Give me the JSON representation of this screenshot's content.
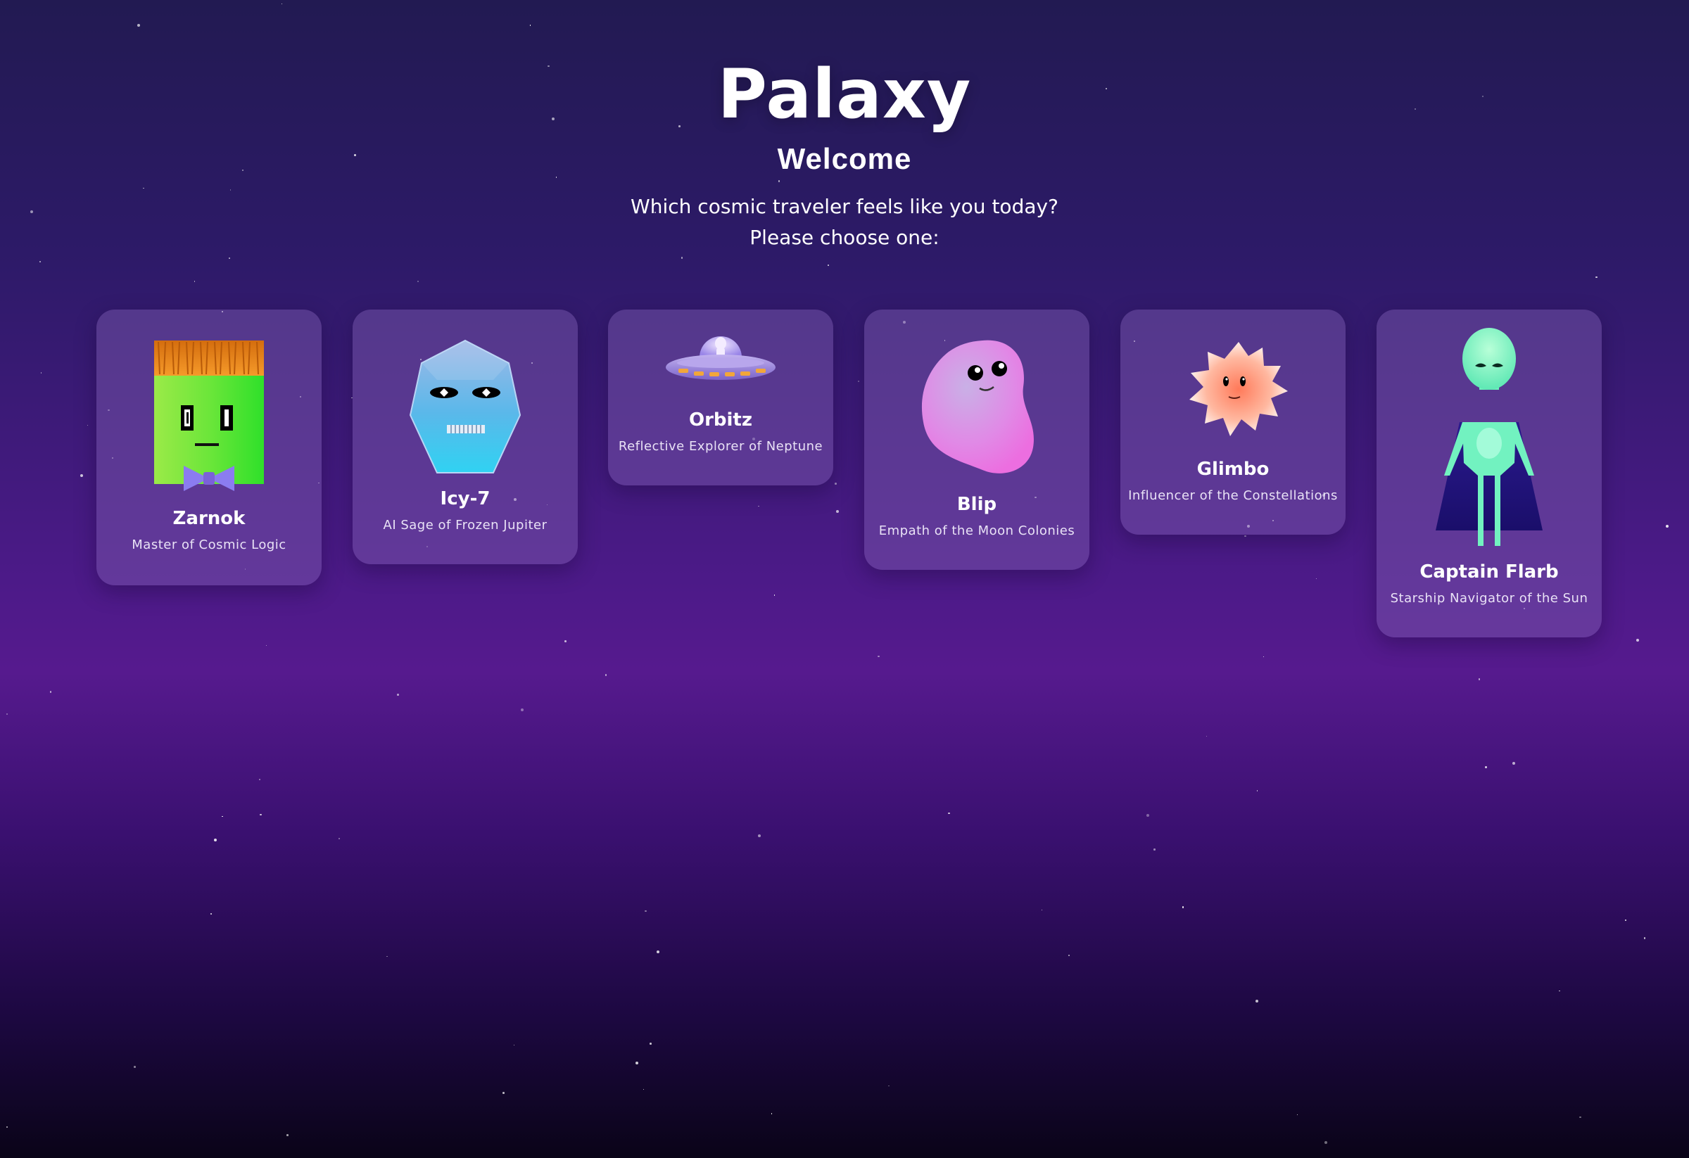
{
  "header": {
    "logo": "Palaxy",
    "welcome": "Welcome",
    "prompt_line1": "Which cosmic traveler feels like you today?",
    "prompt_line2": "Please choose one:"
  },
  "characters": [
    {
      "name": "Zarnok",
      "description": "Master of Cosmic Logic"
    },
    {
      "name": "Icy-7",
      "description": "AI Sage of Frozen Jupiter"
    },
    {
      "name": "Orbitz",
      "description": "Reflective Explorer of Neptune"
    },
    {
      "name": "Blip",
      "description": "Empath of the Moon Colonies"
    },
    {
      "name": "Glimbo",
      "description": "Influencer of the Constellations"
    },
    {
      "name": "Captain Flarb",
      "description": "Starship Navigator of the Sun"
    }
  ],
  "colors": {
    "background_top": "#221a52",
    "background_mid": "#561a8e",
    "background_bottom": "#0a0418",
    "card": "#8462b6"
  },
  "icons": [
    "zarnok-avatar-icon",
    "icy7-avatar-icon",
    "orbitz-ufo-icon",
    "blip-blob-icon",
    "glimbo-star-icon",
    "captain-flarb-alien-icon"
  ]
}
